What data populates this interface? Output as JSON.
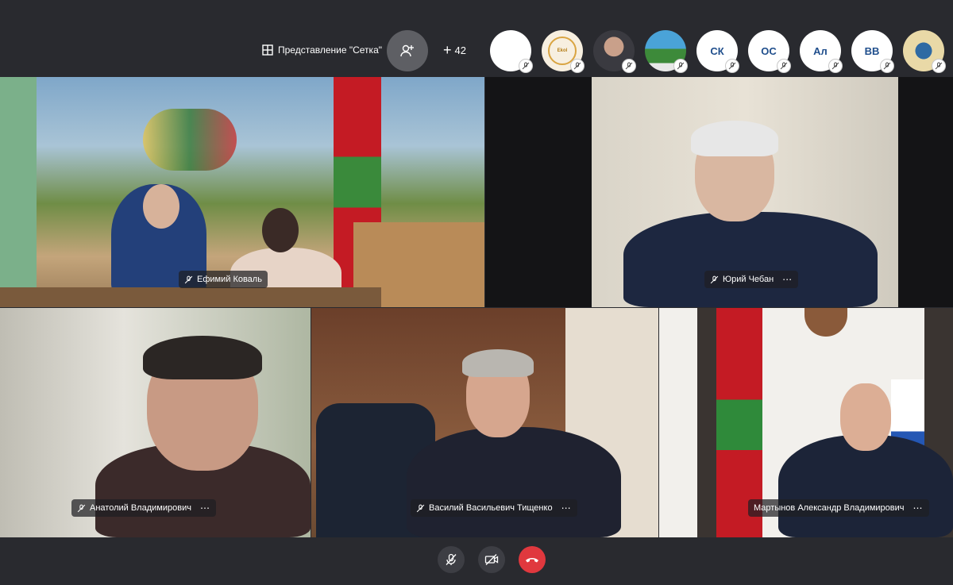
{
  "toolbar": {
    "view_label": "Представление \"Сетка\"",
    "more_participants": "42"
  },
  "avatars": [
    {
      "type": "blank",
      "initials": ""
    },
    {
      "type": "logo",
      "initials": "Ekol"
    },
    {
      "type": "photo",
      "initials": ""
    },
    {
      "type": "flag",
      "initials": ""
    },
    {
      "type": "initials",
      "initials": "СК"
    },
    {
      "type": "initials",
      "initials": "ОС"
    },
    {
      "type": "initials",
      "initials": "Ал"
    },
    {
      "type": "initials",
      "initials": "ВВ"
    },
    {
      "type": "emblem",
      "initials": ""
    }
  ],
  "tiles": {
    "koval": "Ефимий Коваль",
    "cheban": "Юрий Чебан",
    "anatoly": "Анатолий Владимирович",
    "tishchenko": "Василий Васильевич Тищенко",
    "martynov": "Мартынов Александр Владимирович"
  },
  "colors": {
    "background": "#292a2f",
    "end_call": "#e0383e",
    "add_button": "#5e5f64"
  },
  "icons": {
    "view": "grid-icon",
    "add_person": "add-person-icon",
    "mute": "mic-off-icon",
    "camera_off": "camera-off-icon",
    "end_call": "phone-hangup-icon"
  }
}
